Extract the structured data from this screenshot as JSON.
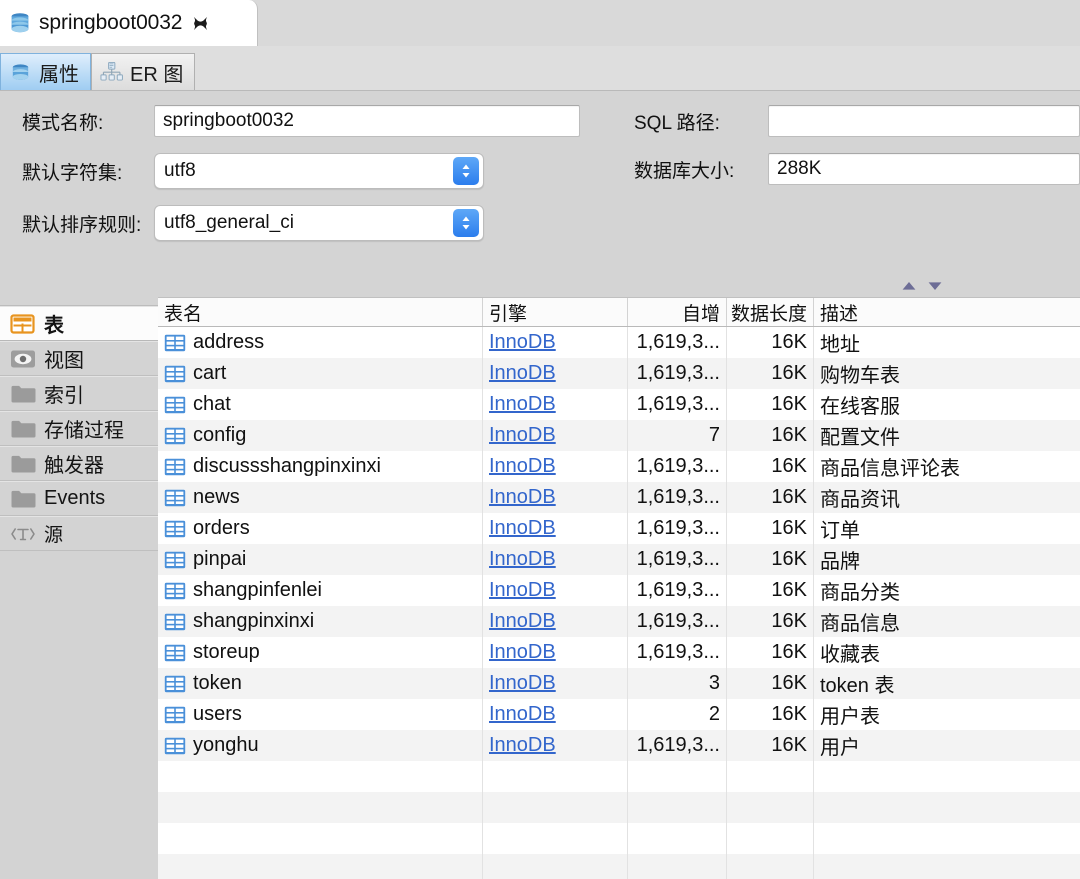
{
  "doc_tab": {
    "title": "springboot0032",
    "icon": "database-icon",
    "close_icon": "close-icon"
  },
  "sub_tabs": [
    {
      "label": "属性",
      "icon": "database-icon",
      "active": true
    },
    {
      "label": "ER 图",
      "icon": "er-diagram-icon",
      "active": false
    }
  ],
  "form": {
    "schema_name": {
      "label": "模式名称:",
      "value": "springboot0032"
    },
    "default_charset": {
      "label": "默认字符集:",
      "value": "utf8"
    },
    "default_collation": {
      "label": "默认排序规则:",
      "value": "utf8_general_ci"
    },
    "sql_path": {
      "label": "SQL 路径:",
      "value": ""
    },
    "db_size": {
      "label": "数据库大小:",
      "value": "288K"
    }
  },
  "sidebar": {
    "items": [
      {
        "label": "表",
        "icon": "table-icon",
        "active": true
      },
      {
        "label": "视图",
        "icon": "eye-icon",
        "active": false
      },
      {
        "label": "索引",
        "icon": "folder-icon",
        "active": false
      },
      {
        "label": "存储过程",
        "icon": "folder-icon",
        "active": false
      },
      {
        "label": "触发器",
        "icon": "folder-icon",
        "active": false
      },
      {
        "label": "Events",
        "icon": "folder-icon",
        "active": false
      },
      {
        "label": "源",
        "icon": "source-code-icon",
        "active": false
      }
    ]
  },
  "table": {
    "sort_asc_icon": "sort-ascending-icon",
    "sort_desc_icon": "sort-descending-icon",
    "columns": [
      "表名",
      "引擎",
      "自增",
      "数据长度",
      "描述"
    ],
    "rows": [
      {
        "name": "address",
        "engine": "InnoDB",
        "auto_increment": "1,619,3...",
        "data_length": "16K",
        "comment": "地址"
      },
      {
        "name": "cart",
        "engine": "InnoDB",
        "auto_increment": "1,619,3...",
        "data_length": "16K",
        "comment": "购物车表"
      },
      {
        "name": "chat",
        "engine": "InnoDB",
        "auto_increment": "1,619,3...",
        "data_length": "16K",
        "comment": "在线客服"
      },
      {
        "name": "config",
        "engine": "InnoDB",
        "auto_increment": "7",
        "data_length": "16K",
        "comment": "配置文件"
      },
      {
        "name": "discussshangpinxinxi",
        "engine": "InnoDB",
        "auto_increment": "1,619,3...",
        "data_length": "16K",
        "comment": "商品信息评论表"
      },
      {
        "name": "news",
        "engine": "InnoDB",
        "auto_increment": "1,619,3...",
        "data_length": "16K",
        "comment": "商品资讯"
      },
      {
        "name": "orders",
        "engine": "InnoDB",
        "auto_increment": "1,619,3...",
        "data_length": "16K",
        "comment": "订单"
      },
      {
        "name": "pinpai",
        "engine": "InnoDB",
        "auto_increment": "1,619,3...",
        "data_length": "16K",
        "comment": "品牌"
      },
      {
        "name": "shangpinfenlei",
        "engine": "InnoDB",
        "auto_increment": "1,619,3...",
        "data_length": "16K",
        "comment": "商品分类"
      },
      {
        "name": "shangpinxinxi",
        "engine": "InnoDB",
        "auto_increment": "1,619,3...",
        "data_length": "16K",
        "comment": "商品信息"
      },
      {
        "name": "storeup",
        "engine": "InnoDB",
        "auto_increment": "1,619,3...",
        "data_length": "16K",
        "comment": "收藏表"
      },
      {
        "name": "token",
        "engine": "InnoDB",
        "auto_increment": "3",
        "data_length": "16K",
        "comment": "token 表"
      },
      {
        "name": "users",
        "engine": "InnoDB",
        "auto_increment": "2",
        "data_length": "16K",
        "comment": "用户表"
      },
      {
        "name": "yonghu",
        "engine": "InnoDB",
        "auto_increment": "1,619,3...",
        "data_length": "16K",
        "comment": "用户"
      }
    ],
    "empty_row_count": 4
  },
  "colors": {
    "window_bg": "#d4d4d4",
    "table_bg": "#ffffff",
    "row_alt": "#f3f3f3",
    "link": "#3366cc",
    "tab_active": "#9fcdf2",
    "table_icon": "#4a90d9",
    "active_table_icon": "#e8941f"
  }
}
